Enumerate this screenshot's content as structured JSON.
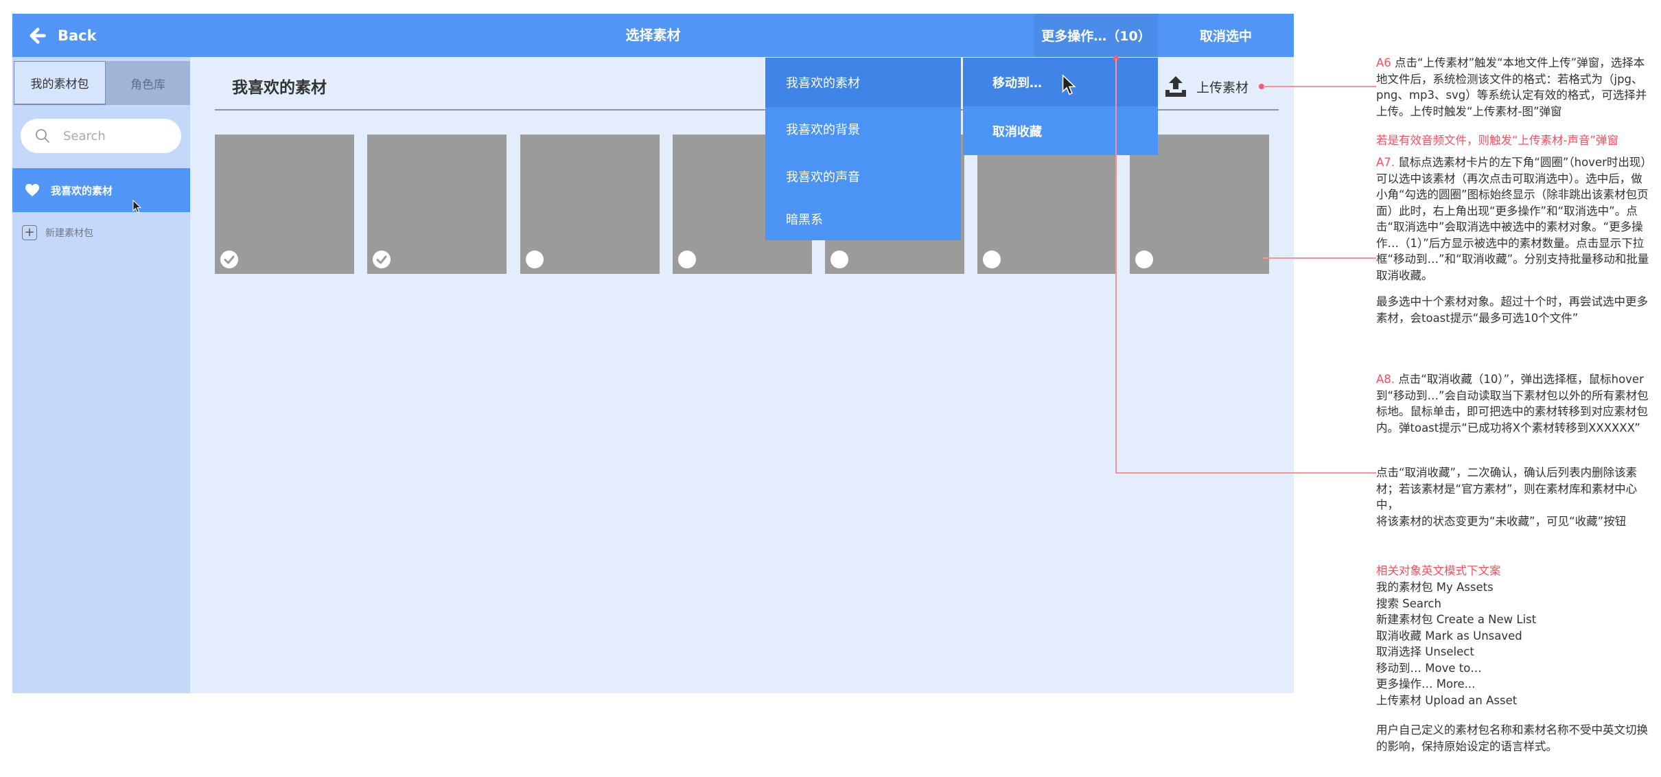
{
  "colors": {
    "primary": "#5196f7",
    "sidebar": "#c4d8fb",
    "content": "#e4edfc",
    "card": "#9b9b9b",
    "annotation": "#ff4c5c"
  },
  "topbar": {
    "back_label": "Back",
    "title": "选择素材",
    "more_label": "更多操作…（10）",
    "unselect_label": "取消选中"
  },
  "sidebar": {
    "tabs": [
      {
        "label": "我的素材包"
      },
      {
        "label": "角色库"
      }
    ],
    "search_placeholder": "Search",
    "selected_item": {
      "label": "我喜欢的素材",
      "icon": "heart-icon"
    },
    "new_list": {
      "label": "新建素材包",
      "icon": "plus-square-icon"
    }
  },
  "main": {
    "section_title": "我喜欢的素材",
    "upload_label": "上传素材",
    "cards": [
      {
        "checked": true
      },
      {
        "checked": true
      },
      {
        "checked": false
      },
      {
        "checked": false
      },
      {
        "checked": false
      },
      {
        "checked": false
      },
      {
        "checked": false
      }
    ]
  },
  "dropdown_lists": {
    "items": [
      {
        "label": "我喜欢的素材"
      },
      {
        "label": "我喜欢的背景"
      },
      {
        "label": "我喜欢的声音"
      },
      {
        "label": "暗黑系"
      }
    ]
  },
  "dropdown_actions": {
    "items": [
      {
        "label": "移动到…"
      },
      {
        "label": "取消收藏"
      }
    ]
  },
  "annotations": {
    "a6_tag": "A6",
    "a6_text": " 点击“上传素材”触发“本地文件上传”弹窗，选择本地文件后，系统检测该文件的格式：若格式为（jpg、png、mp3、svg）等系统认定有效的格式，可选择并上传。上传时触发“上传素材-图”弹窗",
    "a6_audio": "若是有效音频文件，则触发“上传素材-声音”弹窗",
    "a7_tag": "A7.",
    "a7_text": " 鼠标点选素材卡片的左下角“圆圈”（hover时出现）可以选中该素材（再次点击可取消选中）。选中后，做小角“勾选的圆圈”图标始终显示（除非跳出该素材包页面）此时，右上角出现“更多操作”和“取消选中”。点击“取消选中”会取消选中被选中的素材对象。“更多操作…（1）”后方显示被选中的素材数量。点击显示下拉框“移动到…”和“取消收藏”。分别支持批量移动和批量取消收藏。",
    "a7_limit": "最多选中十个素材对象。超过十个时，再尝试选中更多素材，会toast提示“最多可选10个文件”",
    "a8_tag": "A8.",
    "a8_text": " 点击“取消收藏（10）”，弹出选择框，鼠标hover到“移动到…”会自动读取当下素材包以外的所有素材包标地。鼠标单击，即可把选中的素材转移到对应素材包内。弹toast提示“已成功将X个素材转移到XXXXXX”",
    "unfav_text": "点击“取消收藏”，二次确认，确认后列表内删除该素材；若该素材是“官方素材”，则在素材库和素材中心中，",
    "unfav_text2": "将该素材的状态变更为“未收藏”，可见“收藏”按钮",
    "en_title": "相关对象英文模式下文案",
    "en_lines": [
      "我的素材包 My Assets",
      "搜索 Search",
      "新建素材包 Create a New List",
      "取消收藏 Mark as Unsaved",
      "取消选择 Unselect",
      "移动到… Move to…",
      "更多操作… More...",
      "上传素材 Upload an Asset"
    ],
    "footer": "用户自己定义的素材包名称和素材名称不受中英文切换的影响，保持原始设定的语言样式。"
  }
}
